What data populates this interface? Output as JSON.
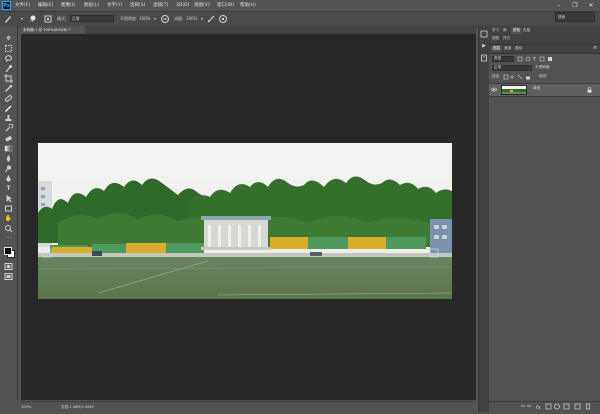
{
  "menu": {
    "logo": "Ps",
    "items": [
      "文件(F)",
      "编辑(E)",
      "图像(I)",
      "图层(L)",
      "文字(Y)",
      "选择(S)",
      "滤镜(T)",
      "3D(D)",
      "视图(V)",
      "窗口(W)",
      "帮助(H)"
    ],
    "minimize": "–",
    "restore": "❐",
    "close": "✕"
  },
  "options": {
    "brush_size": "16",
    "mode_label": "模式:",
    "mode_value": "正常",
    "opacity_label": "不透明度:",
    "opacity_value": "100%",
    "flow_label": "流量:",
    "flow_value": "100%"
  },
  "search": {
    "placeholder": "搜索"
  },
  "document": {
    "tab_label": "未标题-1 @ 100%(RGB/8) *",
    "zoom": "100%",
    "doc_size": "文档:1.46M/1.46M"
  },
  "panels": {
    "top_tabs": [
      "学习",
      "库",
      "颜色",
      "色板"
    ],
    "top_tabs_row2": [
      "调整",
      "样式"
    ],
    "active_group_tabs": [
      "图层",
      "通道",
      "路径"
    ],
    "kind_filter": "类型",
    "blend_mode": "正常",
    "opacity_label": "不透明度:",
    "lock_label": "锁定:",
    "fill_label": "填充:",
    "layer_name": "背景"
  },
  "colors": {
    "menubar": "#535353",
    "workspace": "#282828",
    "canvas_sky": "#f1f1ef",
    "grass": "#5d7a52",
    "trees": "#2f6a2a",
    "stand_yellow": "#d8ad2c",
    "stand_green": "#4d9a5c",
    "ps_blue": "#31a8ff"
  }
}
